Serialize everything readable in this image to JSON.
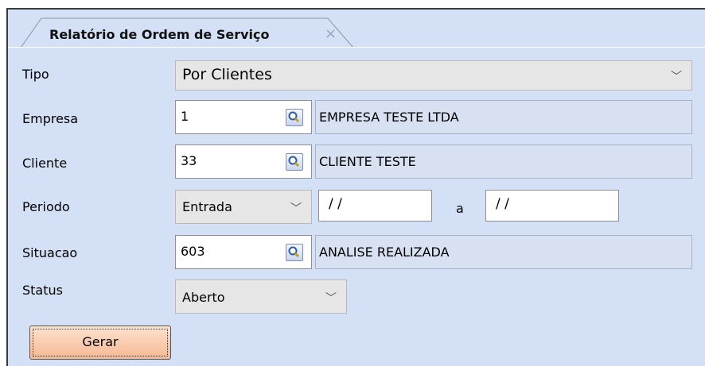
{
  "tab": {
    "title": "Relatório de Ordem de Serviço",
    "close_glyph": "×"
  },
  "fields": {
    "tipo": {
      "label": "Tipo",
      "value": "Por Clientes"
    },
    "empresa": {
      "label": "Empresa",
      "code": "1",
      "description": "EMPRESA TESTE LTDA"
    },
    "cliente": {
      "label": "Cliente",
      "code": "33",
      "description": "CLIENTE TESTE"
    },
    "periodo": {
      "label": "Periodo",
      "type_value": "Entrada",
      "from": "/ /",
      "separator": "a",
      "to": "/ /"
    },
    "situacao": {
      "label": "Situacao",
      "code": "603",
      "description": "ANALISE REALIZADA"
    },
    "status": {
      "label": "Status",
      "value": "Aberto"
    }
  },
  "actions": {
    "generate_label": "Gerar"
  },
  "icons": {
    "lookup": "magnifier-icon",
    "dropdown": "chevron-down-icon"
  },
  "colors": {
    "panel": "#d4e0f5",
    "button": "#f6b994"
  }
}
